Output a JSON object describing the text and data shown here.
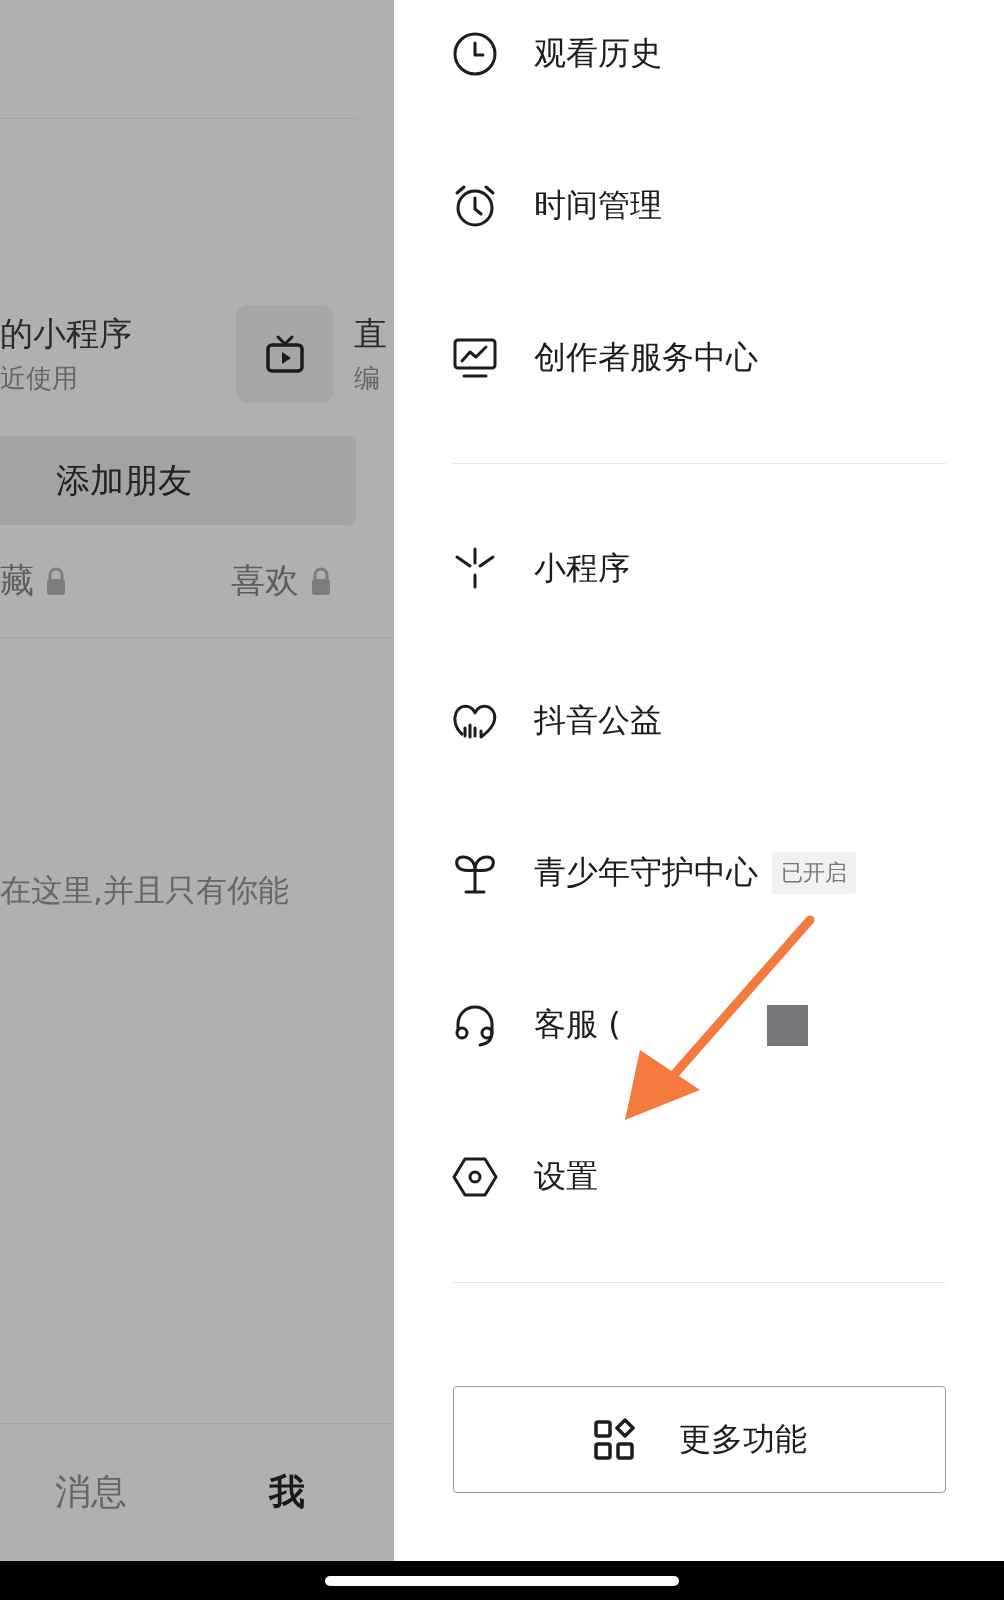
{
  "left_panel": {
    "mini_program": {
      "title": "的小程序",
      "subtitle": "近使用"
    },
    "live": {
      "title": "直",
      "subtitle": "编"
    },
    "add_friend_button": "添加朋友",
    "tabs": [
      {
        "label": "藏",
        "locked": true
      },
      {
        "label": "喜欢",
        "locked": true
      }
    ],
    "empty_message": "在这里,并且只有你能",
    "bottom_nav": [
      {
        "label": "消息",
        "selected": false
      },
      {
        "label": "我",
        "selected": true
      }
    ]
  },
  "menu": {
    "sections": [
      {
        "items": [
          {
            "label": "观看历史"
          },
          {
            "label": "时间管理"
          },
          {
            "label": "创作者服务中心"
          }
        ]
      },
      {
        "items": [
          {
            "label": "小程序"
          },
          {
            "label": "抖音公益"
          },
          {
            "label": "青少年守护中心",
            "badge": "已开启"
          },
          {
            "label": "客服 (",
            "redacted": true
          },
          {
            "label": "设置"
          }
        ]
      }
    ],
    "more_button": "更多功能"
  }
}
